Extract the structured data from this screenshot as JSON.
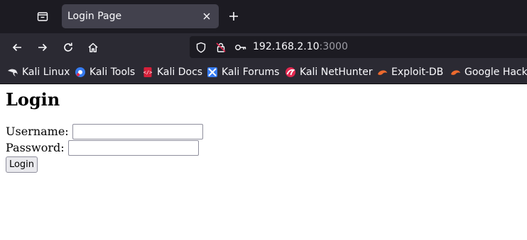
{
  "browser": {
    "tab": {
      "title": "Login Page",
      "active": true
    },
    "nav": {
      "url_host": "192.168.2.10",
      "url_port": ":3000"
    },
    "bookmarks": [
      {
        "label": "Kali Linux",
        "icon": "kali-dragon-icon"
      },
      {
        "label": "Kali Tools",
        "icon": "kali-tools-icon"
      },
      {
        "label": "Kali Docs",
        "icon": "kali-docs-icon"
      },
      {
        "label": "Kali Forums",
        "icon": "kali-forums-icon"
      },
      {
        "label": "Kali NetHunter",
        "icon": "kali-nethunter-icon"
      },
      {
        "label": "Exploit-DB",
        "icon": "exploit-db-icon"
      },
      {
        "label": "Google Hacki",
        "icon": "google-hacking-icon"
      }
    ],
    "colors": {
      "tabstrip_bg": "#1c1b22",
      "toolbar_bg": "#2b2a33",
      "active_tab_bg": "#42414d",
      "text": "#fbfbfe"
    }
  },
  "page": {
    "title": "Login",
    "form": {
      "username_label": "Username:",
      "username_value": "",
      "password_label": "Password:",
      "password_value": "",
      "submit_label": "Login"
    }
  }
}
